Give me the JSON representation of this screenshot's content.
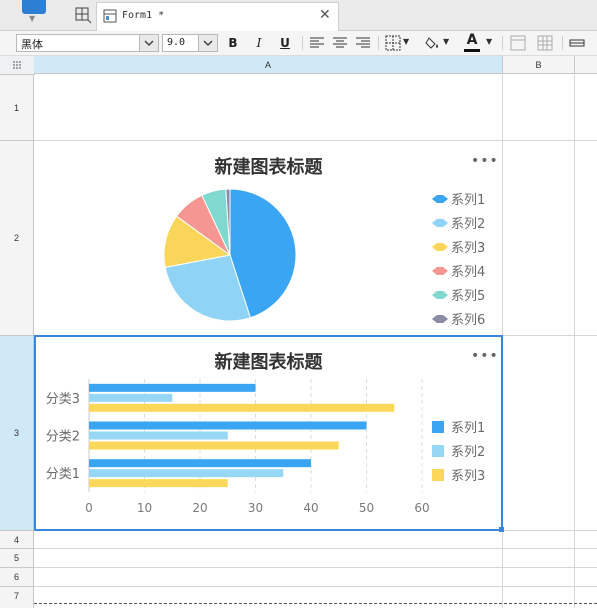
{
  "tabs": {
    "form_tab_label": "Form1 *",
    "close_symbol": "✕"
  },
  "toolbar": {
    "font_name": "黑体",
    "font_size": "9.0",
    "bold": "B",
    "italic": "I",
    "underline": "U",
    "font_color_glyph": "A"
  },
  "sheet": {
    "columns": [
      "A",
      "B"
    ],
    "rows": [
      "1",
      "2",
      "3",
      "4",
      "5",
      "6",
      "7"
    ]
  },
  "colors": {
    "selection": "#3a86dd",
    "header_selected": "#cfe9f6"
  },
  "pie_chart": {
    "title": "新建图表标题",
    "more_glyph": "•••",
    "chart_data": {
      "type": "pie",
      "title": "新建图表标题",
      "series": [
        {
          "name": "系列1",
          "value": 45,
          "color": "#3aa6f3"
        },
        {
          "name": "系列2",
          "value": 27,
          "color": "#8fd3f5"
        },
        {
          "name": "系列3",
          "value": 13,
          "color": "#f9d65a"
        },
        {
          "name": "系列4",
          "value": 8,
          "color": "#f59692"
        },
        {
          "name": "系列5",
          "value": 6,
          "color": "#7fd9ce"
        },
        {
          "name": "系列6",
          "value": 1,
          "color": "#8a8ba6"
        }
      ],
      "legend_position": "right"
    }
  },
  "bar_chart": {
    "title": "新建图表标题",
    "more_glyph": "•••",
    "chart_data": {
      "type": "bar",
      "orientation": "horizontal",
      "title": "新建图表标题",
      "categories": [
        "分类1",
        "分类2",
        "分类3"
      ],
      "series": [
        {
          "name": "系列1",
          "values": [
            40,
            50,
            30
          ],
          "color": "#3aa6f3"
        },
        {
          "name": "系列2",
          "values": [
            35,
            25,
            15
          ],
          "color": "#97d7f6"
        },
        {
          "name": "系列3",
          "values": [
            25,
            45,
            55
          ],
          "color": "#fbd85a"
        }
      ],
      "xlim": [
        0,
        60
      ],
      "xticks": [
        0,
        10,
        20,
        30,
        40,
        50,
        60
      ],
      "grid": true,
      "legend_position": "right"
    }
  }
}
